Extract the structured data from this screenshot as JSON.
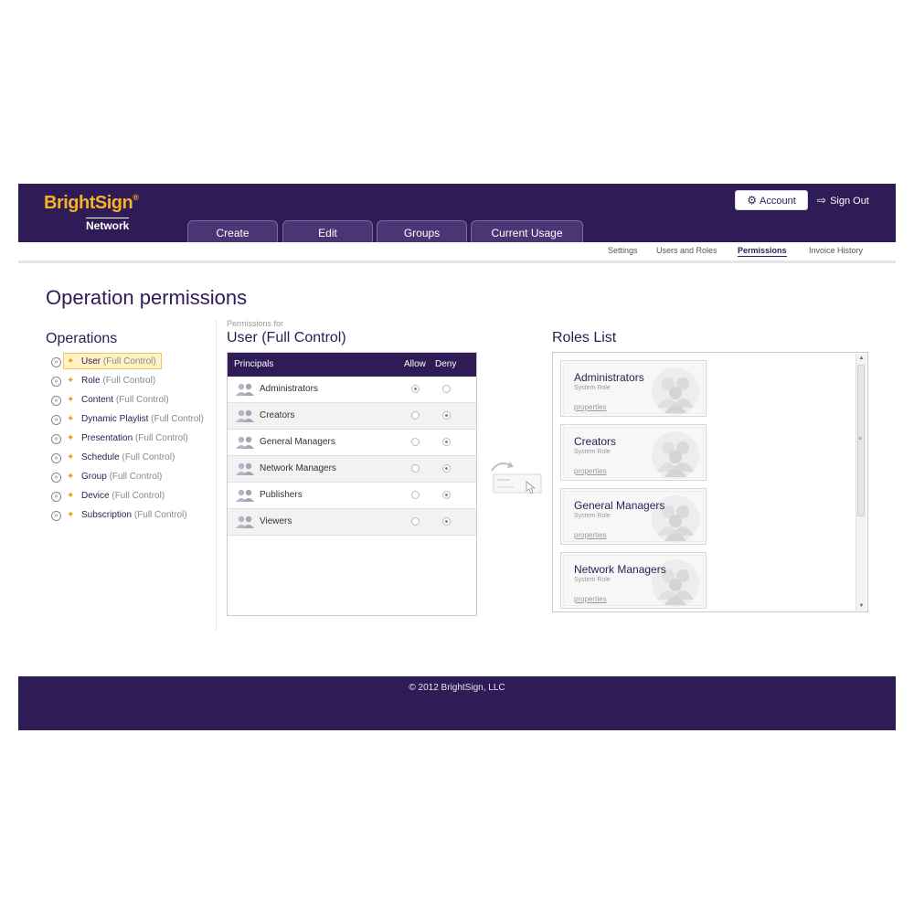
{
  "header": {
    "brand": "BrightSign",
    "brand_mark": "®",
    "brand_sub": "Network",
    "tabs": [
      {
        "label": "Create"
      },
      {
        "label": "Edit"
      },
      {
        "label": "Groups"
      },
      {
        "label": "Current Usage"
      }
    ],
    "account_label": "Account",
    "signout_label": "Sign Out",
    "account_icon": "gears-icon",
    "signout_icon": "sign-out-icon"
  },
  "subnav": [
    {
      "label": "Settings",
      "active": false
    },
    {
      "label": "Users and Roles",
      "active": false
    },
    {
      "label": "Permissions",
      "active": true
    },
    {
      "label": "Invoice History",
      "active": false
    }
  ],
  "page": {
    "title": "Operation permissions"
  },
  "operations": {
    "title": "Operations",
    "items": [
      {
        "name": "User",
        "tag": "(Full Control)",
        "selected": true
      },
      {
        "name": "Role",
        "tag": "(Full Control)",
        "selected": false
      },
      {
        "name": "Content",
        "tag": "(Full Control)",
        "selected": false
      },
      {
        "name": "Dynamic Playlist",
        "tag": "(Full Control)",
        "selected": false
      },
      {
        "name": "Presentation",
        "tag": "(Full Control)",
        "selected": false
      },
      {
        "name": "Schedule",
        "tag": "(Full Control)",
        "selected": false
      },
      {
        "name": "Group",
        "tag": "(Full Control)",
        "selected": false
      },
      {
        "name": "Device",
        "tag": "(Full Control)",
        "selected": false
      },
      {
        "name": "Subscription",
        "tag": "(Full Control)",
        "selected": false
      }
    ]
  },
  "permissions": {
    "label": "Permissions for",
    "title": "User (Full Control)",
    "columns": {
      "principals": "Principals",
      "allow": "Allow",
      "deny": "Deny"
    },
    "rows": [
      {
        "name": "Administrators",
        "value": "allow"
      },
      {
        "name": "Creators",
        "value": "deny"
      },
      {
        "name": "General Managers",
        "value": "deny"
      },
      {
        "name": "Network Managers",
        "value": "deny"
      },
      {
        "name": "Publishers",
        "value": "deny"
      },
      {
        "name": "Viewers",
        "value": "deny"
      }
    ]
  },
  "roles": {
    "title": "Roles List",
    "items": [
      {
        "name": "Administrators",
        "type": "System Role",
        "link": "properties"
      },
      {
        "name": "Creators",
        "type": "System Role",
        "link": "properties"
      },
      {
        "name": "General Managers",
        "type": "System Role",
        "link": "properties"
      },
      {
        "name": "Network Managers",
        "type": "System Role",
        "link": "properties"
      }
    ]
  },
  "footer": {
    "copyright": "© 2012 BrightSign, LLC"
  },
  "colors": {
    "brand_purple": "#2f1b56",
    "brand_gold": "#f5b324",
    "selected_highlight": "#fff3c6"
  }
}
